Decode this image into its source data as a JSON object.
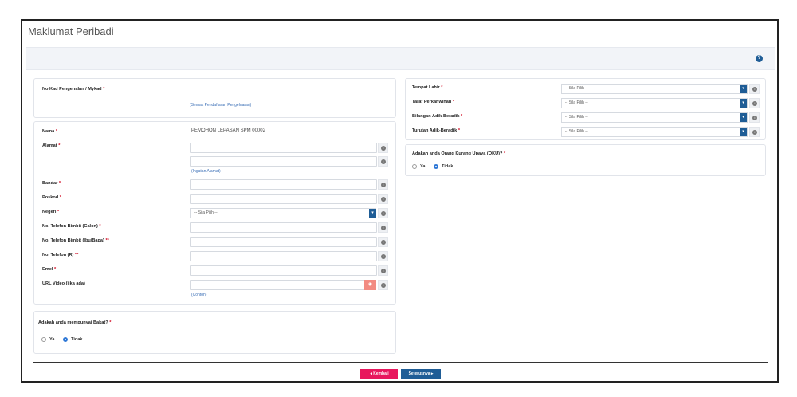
{
  "page_title": "Maklumat Peribadi",
  "ic_panel": {
    "label": "No Kad Pengenalan / Mykad",
    "req": "*",
    "link": "(Semak Pendaftaran Pengeluaran)"
  },
  "form": {
    "nama": {
      "label": "Nama",
      "req": "*",
      "value": "PEMOHON LEPASAN SPM 00002"
    },
    "alamat": {
      "label": "Alamat",
      "req": "*",
      "link": "(Ingatan Alamat)"
    },
    "bandar": {
      "label": "Bandar",
      "req": "*"
    },
    "poskod": {
      "label": "Poskod",
      "req": "*"
    },
    "negeri": {
      "label": "Negeri",
      "req": "*",
      "selected": "-- Sila Pilih --"
    },
    "tel_calon": {
      "label": "No. Telefon Bimbit (Calon)",
      "req": "*"
    },
    "tel_ibubapa": {
      "label": "No. Telefon Bimbit (Ibu/Bapa)",
      "req": "**"
    },
    "tel_rumah": {
      "label": "No. Telefon (R)",
      "req": "**"
    },
    "emel": {
      "label": "Emel",
      "req": "*"
    },
    "url_video": {
      "label": "URL Video (jika ada)",
      "link": "(Contoh)"
    }
  },
  "bakat": {
    "question": "Adakah anda mempunyai Bakat?",
    "req": "*",
    "options": [
      "Ya",
      "Tidak"
    ],
    "selected": "Tidak"
  },
  "right": {
    "tempat_lahir": {
      "label": "Tempat Lahir",
      "req": "*",
      "selected": "-- Sila Pilih --"
    },
    "taraf": {
      "label": "Taraf Perkahwinan",
      "req": "*",
      "selected": "-- Sila Pilih --"
    },
    "bil_adik": {
      "label": "Bilangan Adik-Beradik",
      "req": "*",
      "selected": "-- Sila Pilih --"
    },
    "turutan": {
      "label": "Turutan Adik-Beradik",
      "req": "*",
      "selected": "-- Sila Pilih --"
    }
  },
  "oku": {
    "question": "Adakah anda Orang Kurang Upaya (OKU)?",
    "req": "*",
    "options": [
      "Ya",
      "Tidak"
    ],
    "selected": "Tidak"
  },
  "buttons": {
    "back": "Kembali",
    "next": "Seterusnya"
  },
  "icons": {
    "help": "question-circle-icon",
    "info": "info-icon",
    "eye": "eye-icon"
  },
  "colors": {
    "primary": "#1f5d96",
    "danger": "#e8175d",
    "required": "#d0021b",
    "link": "#3b6fb6"
  }
}
